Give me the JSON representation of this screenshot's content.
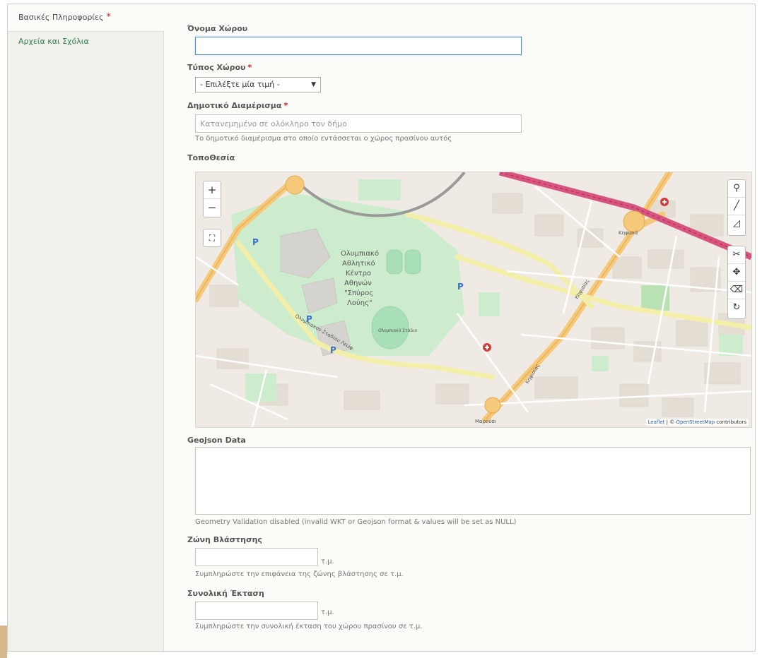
{
  "sidebar": {
    "tabs": [
      {
        "label": "Βασικές Πληροφορίες",
        "required_mark": "*"
      },
      {
        "label": "Αρχεία και Σχόλια"
      }
    ]
  },
  "form": {
    "name": {
      "label": "Όνομα Χώρου",
      "value": ""
    },
    "type": {
      "label": "Τύπος Χώρου",
      "required_mark": "*",
      "selected": "- Επιλέξτε μία τιμή -"
    },
    "district": {
      "label": "Δημοτικό Διαμέρισμα",
      "required_mark": "*",
      "placeholder": "Κατανεμημένο σε ολόκληρο τον δήμο",
      "description": "Το δημοτικό διαμέρισμα στο οποίο εντάσσεται ο χώρος πρασίνου αυτός"
    },
    "location": {
      "label": "ΤοποΘεσία"
    },
    "geojson": {
      "label": "Geojson Data",
      "value": "",
      "description": "Geometry Validation disabled (invalid WKT or Geojson format & values will be set as NULL)"
    },
    "growth_zone": {
      "label": "Ζώνη Βλάστησης",
      "unit": "τ.μ.",
      "description": "Συμπληρώστε την επιφάνεια της ζώνης βλάστησης σε τ.μ."
    },
    "total_area": {
      "label": "Συνολική Έκταση",
      "unit": "τ.μ.",
      "description": "Συμπληρώστε την συνολική έκταση του χώρου πρασίνου σε τ.μ."
    }
  },
  "map": {
    "zoom_in": "+",
    "zoom_out": "−",
    "stadium_label": [
      "Ολυμπιακό",
      "Αθλητικό",
      "Κέντρο",
      "Αθηνών",
      "\"Σπύρος",
      "Λούης\""
    ],
    "station_label": "Κηφισιά",
    "road_label_1": "Κηφισίας",
    "road_label_2": "Κηφισίας",
    "road_label_3": "Μαρούσι",
    "road_label_4": "Ολυμπιακού Σταδίου Λεωφ.",
    "stadium_text": "Ολυμπιακό Στάδιο",
    "parking": "P",
    "attribution": {
      "leaflet": "Leaflet",
      "sep": " | © ",
      "osm": "OpenStreetMap",
      "contrib": " contributors"
    },
    "colors": {
      "road_major": "#f6c87a",
      "road_minor": "#ffffff",
      "road_yellow": "#f3eea8",
      "park": "#cdeccd",
      "rail": "#d9537f",
      "pitch": "#a9dfb6"
    }
  }
}
